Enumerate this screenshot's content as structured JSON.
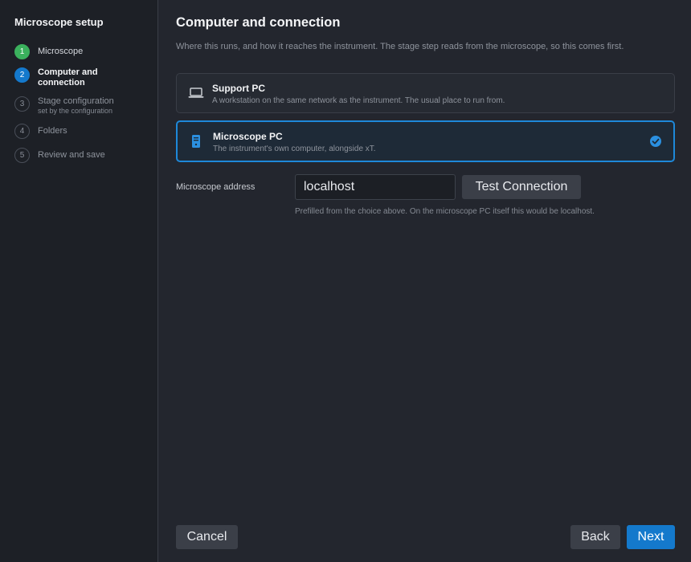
{
  "sidebar": {
    "title": "Microscope setup",
    "steps": [
      {
        "number": "1",
        "label": "Microscope",
        "subtitle": "",
        "status": "done"
      },
      {
        "number": "2",
        "label": "Computer and connection",
        "subtitle": "",
        "status": "active"
      },
      {
        "number": "3",
        "label": "Stage configuration",
        "subtitle": "set by the configuration",
        "status": "pending"
      },
      {
        "number": "4",
        "label": "Folders",
        "subtitle": "",
        "status": "pending"
      },
      {
        "number": "5",
        "label": "Review and save",
        "subtitle": "",
        "status": "pending"
      }
    ]
  },
  "main": {
    "title": "Computer and connection",
    "description": "Where this runs, and how it reaches the instrument. The stage step reads from the microscope, so this comes first.",
    "options": [
      {
        "title": "Support PC",
        "description": "A workstation on the same network as the instrument. The usual place to run from.",
        "icon": "laptop-icon",
        "selected": false
      },
      {
        "title": "Microscope PC",
        "description": "The instrument's own computer, alongside xT.",
        "icon": "tower-pc-icon",
        "selected": true
      }
    ],
    "address": {
      "label": "Microscope address",
      "value": "localhost",
      "test_button": "Test Connection",
      "hint": "Prefilled from the choice above. On the microscope PC itself this would be localhost."
    }
  },
  "footer": {
    "cancel": "Cancel",
    "back": "Back",
    "next": "Next"
  },
  "colors": {
    "accent": "#1479cc",
    "done": "#3bb15d",
    "background": "#23262e",
    "sidebar": "#1d2026"
  }
}
